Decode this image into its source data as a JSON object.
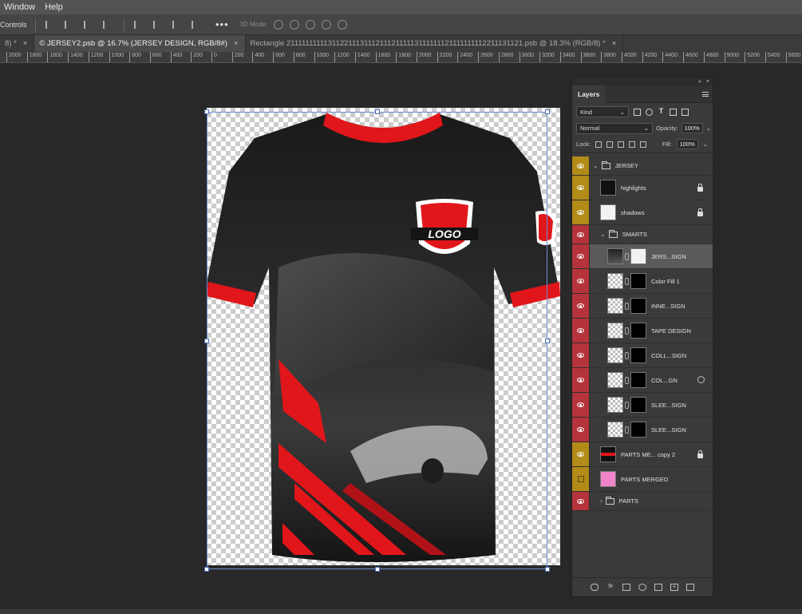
{
  "menu": {
    "items": [
      "Window",
      "Help"
    ]
  },
  "options": {
    "controls_label": "Controls",
    "mode3d_label": "3D Mode:",
    "more": "•••"
  },
  "tabs": [
    {
      "label": "8) *",
      "close": "×",
      "active": false
    },
    {
      "label": "© JERSEY2.psb @ 16.7% (JERSEY DESIGN, RGB/8#)",
      "close": "×",
      "active": true
    },
    {
      "label": "Rectangle 2111111111131122111311121112111113111111121111111112211131121.psb @ 18.3% (RGB/8) *",
      "close": "×",
      "active": false
    }
  ],
  "ruler": [
    "2000",
    "1800",
    "1600",
    "1400",
    "1200",
    "1000",
    "800",
    "600",
    "400",
    "200",
    "0",
    "200",
    "400",
    "600",
    "800",
    "1000",
    "1200",
    "1400",
    "1600",
    "1800",
    "2000",
    "2200",
    "2400",
    "2600",
    "2800",
    "3000",
    "3200",
    "3400",
    "3600",
    "3800",
    "4000",
    "4200",
    "4400",
    "4600",
    "4800",
    "5000",
    "5200",
    "5400",
    "5600",
    "5800"
  ],
  "colors": {
    "accent_red": "#e0161b",
    "jersey_black": "#141414",
    "eye_yellow": "#b28b18",
    "eye_red": "#b5333a"
  },
  "jersey": {
    "logo_text": "LOGO"
  },
  "layers_panel": {
    "title": "Layers",
    "filter_kind": "Kind",
    "blend_mode": "Normal",
    "opacity_label": "Opacity:",
    "opacity": "100%",
    "lock_label": "Lock:",
    "fill_label": "Fill:",
    "fill": "100%",
    "layers": [
      {
        "name": "JERSEY",
        "kind": "group",
        "eye": "yellow",
        "indent": 0,
        "open": true
      },
      {
        "name": "highlights",
        "kind": "layer",
        "eye": "yellow",
        "indent": 1,
        "thumb": "black-shirt",
        "locked": true
      },
      {
        "name": "shadows",
        "kind": "layer",
        "eye": "yellow",
        "indent": 1,
        "thumb": "white-shirt",
        "locked": true
      },
      {
        "name": "SMARTS",
        "kind": "group",
        "eye": "red",
        "indent": 1,
        "open": true
      },
      {
        "name": "JERS...SIGN",
        "kind": "masked",
        "eye": "red",
        "indent": 2,
        "thumb": "design",
        "mask": "white-shirt",
        "selected": true
      },
      {
        "name": "Color Fill 1",
        "kind": "masked",
        "eye": "red",
        "indent": 2,
        "thumb": "checker",
        "mask": "black-shirt-white"
      },
      {
        "name": "INNE...SIGN",
        "kind": "masked",
        "eye": "red",
        "indent": 2,
        "thumb": "checker",
        "mask": "black"
      },
      {
        "name": "TAPE DESIGN",
        "kind": "masked",
        "eye": "red",
        "indent": 2,
        "thumb": "checker",
        "mask": "black"
      },
      {
        "name": "COLL...SIGN",
        "kind": "masked",
        "eye": "red",
        "indent": 2,
        "thumb": "checker",
        "mask": "black"
      },
      {
        "name": "COL...GN",
        "kind": "masked",
        "eye": "red",
        "indent": 2,
        "thumb": "checker",
        "mask": "black",
        "extra": true
      },
      {
        "name": "SLEE...SIGN",
        "kind": "masked",
        "eye": "red",
        "indent": 2,
        "thumb": "checker-black",
        "mask": "black"
      },
      {
        "name": "SLEE...SIGN",
        "kind": "masked",
        "eye": "red",
        "indent": 2,
        "thumb": "checker",
        "mask": "black"
      },
      {
        "name": "PARTS ME... copy 2",
        "kind": "layer",
        "eye": "yellow",
        "indent": 1,
        "thumb": "red-black",
        "locked": true
      },
      {
        "name": "PARTS MERGED",
        "kind": "layer",
        "eye": "yellow-off",
        "indent": 1,
        "thumb": "pink-shirt"
      },
      {
        "name": "PARTS",
        "kind": "group",
        "eye": "red",
        "indent": 1,
        "open": false
      }
    ]
  }
}
